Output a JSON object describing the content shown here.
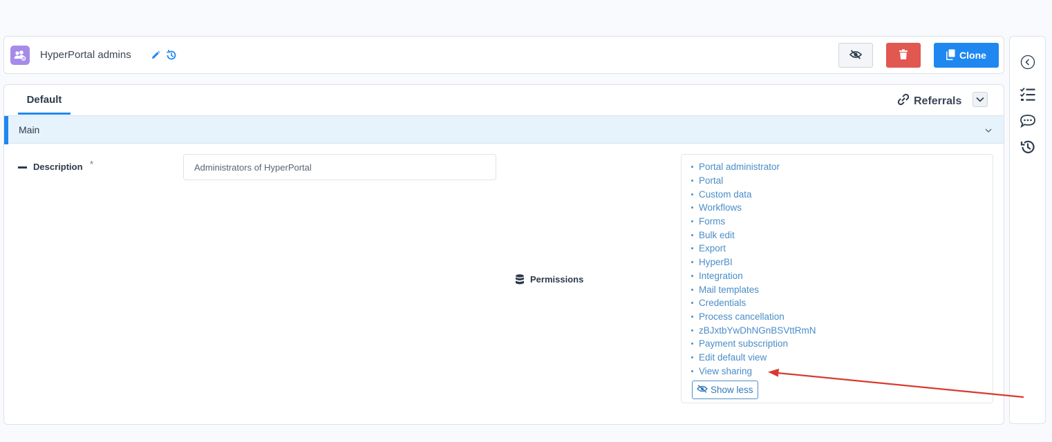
{
  "header": {
    "title": "HyperPortal admins",
    "clone_label": "Clone",
    "icons": {
      "app": "users-gear-icon",
      "edit": "pencil-icon",
      "history": "history-icon",
      "hide": "eye-slash-icon",
      "delete": "trash-icon",
      "clone": "copy-icon"
    }
  },
  "tabs": {
    "default_label": "Default",
    "referrals_label": "Referrals"
  },
  "section": {
    "title": "Main"
  },
  "fields": {
    "description": {
      "label": "Description",
      "required_mark": "*",
      "value": "Administrators of HyperPortal"
    },
    "permissions": {
      "label": "Permissions",
      "items": [
        "Portal administrator",
        "Portal",
        "Custom data",
        "Workflows",
        "Forms",
        "Bulk edit",
        "Export",
        "HyperBI",
        "Integration",
        "Mail templates",
        "Credentials",
        "Process cancellation",
        "zBJxtbYwDhNGnBSVttRmN",
        "Payment subscription",
        "Edit default view",
        "View sharing"
      ],
      "show_less_label": "Show less"
    }
  },
  "rail": {
    "icons": [
      "collapse-left-icon",
      "task-list-icon",
      "comments-icon",
      "history-icon"
    ]
  },
  "colors": {
    "accent": "#1e88f0",
    "danger": "#e05850",
    "link": "#4a8dc8",
    "annotation_arrow": "#d9392f"
  }
}
